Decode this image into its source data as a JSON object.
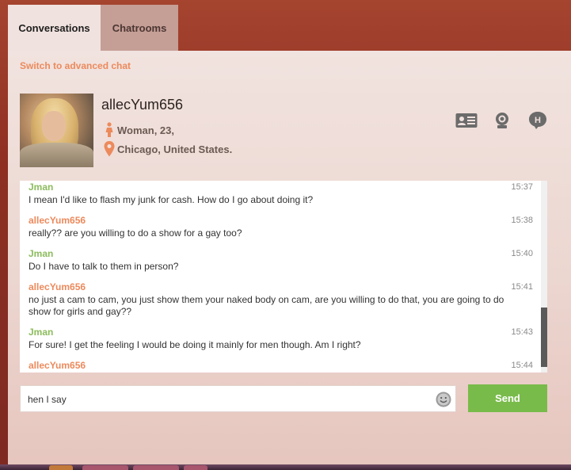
{
  "tabs": [
    {
      "label": "Conversations",
      "active": true
    },
    {
      "label": "Chatrooms",
      "active": false
    }
  ],
  "advanced_link": "Switch to advanced chat",
  "profile": {
    "username": "allecYum656",
    "gender_age": "Woman, 23,",
    "location": "Chicago, United States."
  },
  "icons": {
    "gender": "female-icon",
    "location": "location-pin-icon",
    "profile_card": "id-card-icon",
    "webcam": "webcam-icon",
    "help": "chat-help-icon",
    "emoji": "smiley-icon"
  },
  "colors": {
    "accent_orange": "#ec8a5c",
    "accent_green": "#8cbc5d",
    "send_button": "#79bb4a"
  },
  "messages": [
    {
      "from": "Jman",
      "time": "15:37",
      "text": "I mean I'd like to flash my junk for cash. How do I go about doing it?"
    },
    {
      "from": "allecYum656",
      "time": "15:38",
      "text": "really?? are you willing to do a show for a gay too?"
    },
    {
      "from": "Jman",
      "time": "15:40",
      "text": "Do I have to talk to them in person?"
    },
    {
      "from": "allecYum656",
      "time": "15:41",
      "text": "no just a cam to cam, you just show them your naked body on cam, are you willing to do that, you are going to do show for girls and gay??"
    },
    {
      "from": "Jman",
      "time": "15:43",
      "text": "For sure! I get the feeling I would be doing it mainly for men though. Am I right?"
    },
    {
      "from": "allecYum656",
      "time": "15:44",
      "text": ""
    }
  ],
  "input": {
    "value": "hen I say"
  },
  "send_label": "Send"
}
